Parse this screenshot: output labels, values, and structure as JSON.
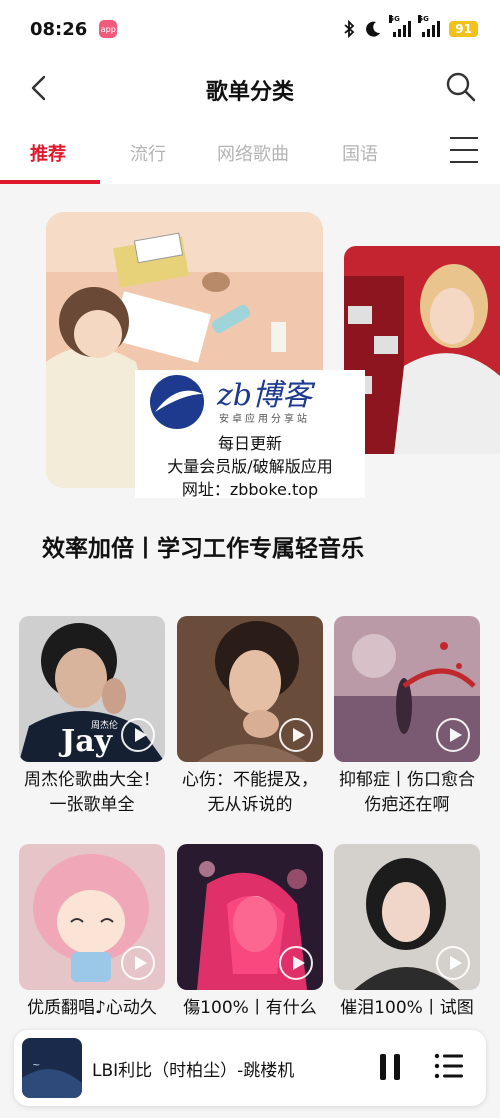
{
  "status_bar": {
    "time": "08:26",
    "app_badge": "app",
    "signal_1_tag": "5G",
    "signal_2_tag": "5G",
    "battery": "91"
  },
  "nav": {
    "title": "歌单分类",
    "back_icon": "chevron-left-icon",
    "search_icon": "search-icon"
  },
  "tabs": {
    "items": [
      {
        "label": "推荐",
        "active": true
      },
      {
        "label": "流行",
        "active": false
      },
      {
        "label": "网络歌曲",
        "active": false
      },
      {
        "label": "国语",
        "active": false
      }
    ],
    "menu_icon": "hamburger-menu-icon"
  },
  "watermark": {
    "brand": "zb博客",
    "tagline": "安卓应用分享站",
    "line1": "每日更新",
    "line2": "大量会员版/破解版应用",
    "line3": "网址：zbboke.top"
  },
  "section_title": "效率加倍丨学习工作专属轻音乐",
  "playlists": [
    {
      "title": "周杰伦歌曲大全！一张歌单全",
      "cover_text": "Jay",
      "cover_small": "周杰伦"
    },
    {
      "title": "心伤：不能提及，无从诉说的"
    },
    {
      "title": "抑郁症丨伤口愈合伤疤还在啊"
    },
    {
      "title": "优质翻唱♪心动久"
    },
    {
      "title": "傷100%丨有什么"
    },
    {
      "title": "催泪100%丨试图"
    }
  ],
  "player": {
    "now_playing": "LBI利比（时柏尘）-跳楼机",
    "pause_icon": "pause-icon",
    "playlist_icon": "playlist-icon"
  },
  "colors": {
    "accent": "#e01a2c",
    "inactive_tab": "#b4b4b4",
    "battery": "#f2c21a"
  }
}
